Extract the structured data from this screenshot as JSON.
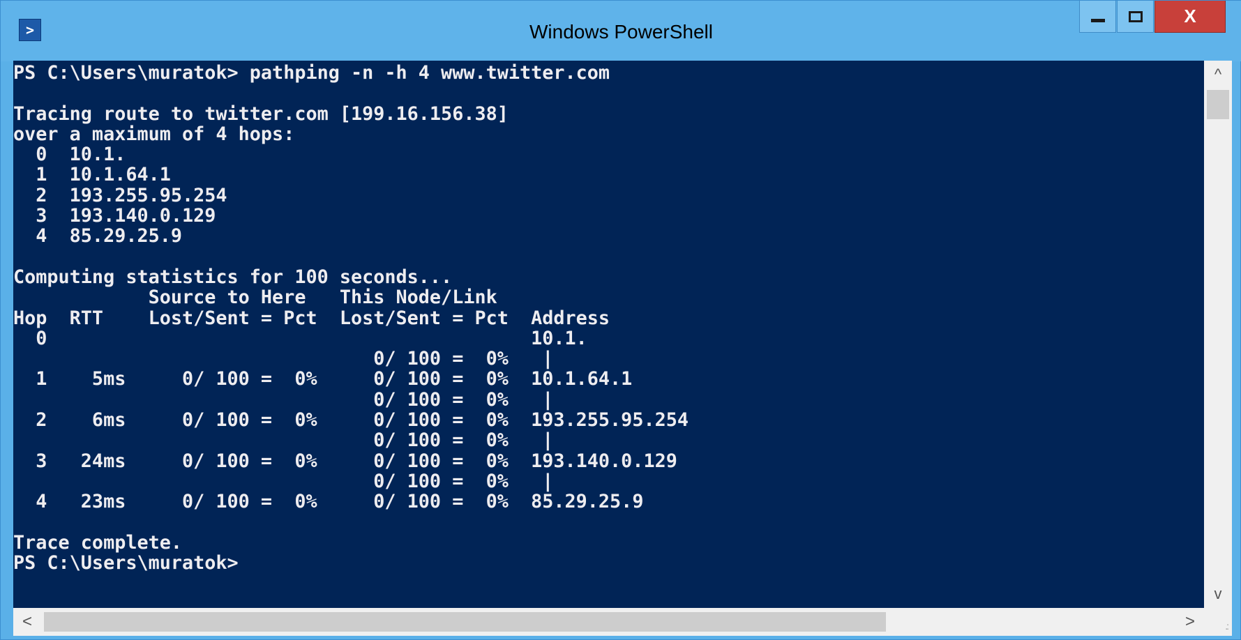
{
  "window": {
    "title": "Windows PowerShell",
    "app_icon": "powershell-icon",
    "controls": {
      "minimize": "minimize-icon",
      "maximize": "maximize-icon",
      "close": "close-icon",
      "close_glyph": "X"
    },
    "colors": {
      "titlebar": "#5fb3ea",
      "console_background": "#012456",
      "console_text": "#eeedf0",
      "close_button": "#c8403a"
    }
  },
  "console": {
    "lines": [
      "PS C:\\Users\\muratok> pathping -n -h 4 www.twitter.com",
      "",
      "Tracing route to twitter.com [199.16.156.38]",
      "over a maximum of 4 hops:",
      "  0  10.1.",
      "  1  10.1.64.1",
      "  2  193.255.95.254",
      "  3  193.140.0.129",
      "  4  85.29.25.9",
      "",
      "Computing statistics for 100 seconds...",
      "            Source to Here   This Node/Link",
      "Hop  RTT    Lost/Sent = Pct  Lost/Sent = Pct  Address",
      "  0                                           10.1.",
      "                                0/ 100 =  0%   |",
      "  1    5ms     0/ 100 =  0%     0/ 100 =  0%  10.1.64.1",
      "                                0/ 100 =  0%   |",
      "  2    6ms     0/ 100 =  0%     0/ 100 =  0%  193.255.95.254",
      "                                0/ 100 =  0%   |",
      "  3   24ms     0/ 100 =  0%     0/ 100 =  0%  193.140.0.129",
      "                                0/ 100 =  0%   |",
      "  4   23ms     0/ 100 =  0%     0/ 100 =  0%  85.29.25.9",
      "",
      "Trace complete.",
      "PS C:\\Users\\muratok>"
    ]
  },
  "scrollbars": {
    "up_arrow": "^",
    "down_arrow": "v",
    "left_arrow": "<",
    "right_arrow": ">",
    "grip": ".:"
  }
}
